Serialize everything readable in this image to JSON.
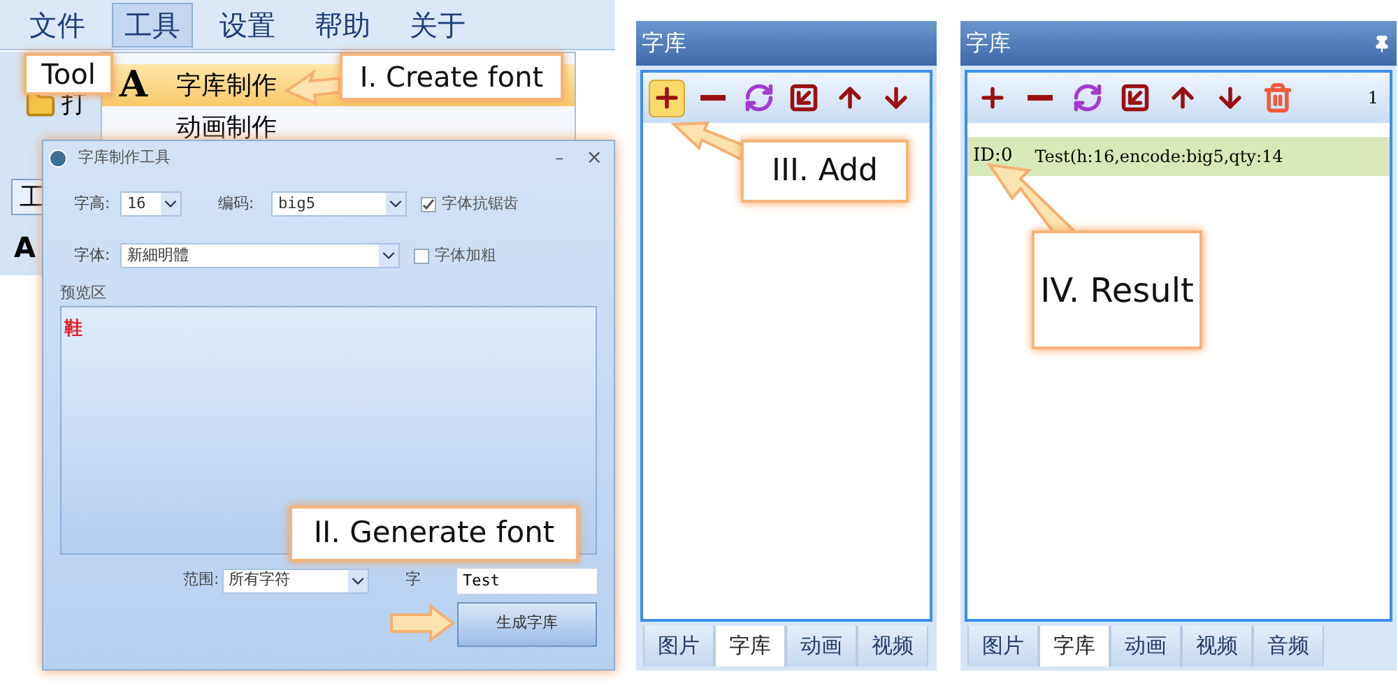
{
  "menu_window": {
    "menu_bar": [
      {
        "label": "文件",
        "selected": false
      },
      {
        "label": "工具",
        "selected": true
      },
      {
        "label": "设置",
        "selected": false
      },
      {
        "label": "帮助",
        "selected": false
      },
      {
        "label": "关于",
        "selected": false
      }
    ],
    "dropdown": [
      {
        "icon_letter": "A",
        "label": "字库制作",
        "selected": true
      },
      {
        "label": "动画制作",
        "selected": false
      }
    ],
    "side_texts": [
      "打",
      "工",
      "A"
    ]
  },
  "dialog": {
    "title": "字库制作工具",
    "minimize": "–",
    "close": "×",
    "height_label": "字高:",
    "height_value": "16",
    "encoding_label": "编码:",
    "encoding_value": "big5",
    "antialias": {
      "label": "字体抗锯齿",
      "checked": true
    },
    "font_label": "字体:",
    "font_value": "新細明體",
    "bold": {
      "label": "字体加粗",
      "checked": false
    },
    "preview_label": "预览区",
    "preview_char": "鞋",
    "range_label": "范围:",
    "range_value": "所有字符",
    "name_label": "字",
    "name_value": "Test",
    "generate_button": "生成字库"
  },
  "panels": [
    {
      "title": "字库",
      "toolbar": [
        {
          "kind": "add",
          "selected": true
        },
        {
          "kind": "remove",
          "selected": false
        },
        {
          "kind": "refresh",
          "selected": false
        },
        {
          "kind": "export",
          "selected": false
        },
        {
          "kind": "up",
          "selected": false
        },
        {
          "kind": "down",
          "selected": false
        }
      ],
      "tabs": [
        {
          "label": "图片",
          "selected": false
        },
        {
          "label": "字库",
          "selected": true
        },
        {
          "label": "动画",
          "selected": false
        },
        {
          "label": "视频",
          "selected": false
        }
      ]
    },
    {
      "title": "字库",
      "pin": true,
      "count": "1",
      "toolbar": [
        {
          "kind": "add",
          "selected": false
        },
        {
          "kind": "remove",
          "selected": false
        },
        {
          "kind": "refresh",
          "selected": false
        },
        {
          "kind": "export",
          "selected": false
        },
        {
          "kind": "up",
          "selected": false
        },
        {
          "kind": "down",
          "selected": false
        },
        {
          "kind": "delete",
          "selected": false
        }
      ],
      "rows": [
        {
          "id": "ID:0",
          "text": "Test(h:16,encode:big5,qty:14",
          "selected": true
        }
      ],
      "tabs": [
        {
          "label": "图片",
          "selected": false
        },
        {
          "label": "字库",
          "selected": true
        },
        {
          "label": "动画",
          "selected": false
        },
        {
          "label": "视频",
          "selected": false
        },
        {
          "label": "音频",
          "selected": false
        }
      ]
    }
  ],
  "callouts": [
    {
      "text": "Tool"
    },
    {
      "text": "I. Create font"
    },
    {
      "text": "II. Generate font"
    },
    {
      "text": "III. Add"
    },
    {
      "text": "IV. Result"
    }
  ]
}
